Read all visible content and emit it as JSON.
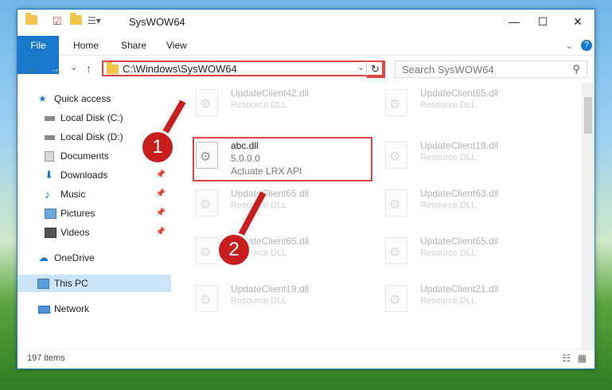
{
  "window": {
    "title": "SysWOW64",
    "minimize": "—",
    "maximize": "☐",
    "close": "✕"
  },
  "ribbon": {
    "file": "File",
    "home": "Home",
    "share": "Share",
    "view": "View",
    "help": "?",
    "collapse": "⌄"
  },
  "nav": {
    "back": "←",
    "forward": "→",
    "recent": "⌄",
    "up": "↑"
  },
  "address": {
    "path": "C:\\Windows\\SysWOW64",
    "dropdown": "⌄",
    "refresh": "↻"
  },
  "search": {
    "placeholder": "Search SysWOW64"
  },
  "sidebar": {
    "items": [
      {
        "label": "Quick access",
        "icon": "star-icon"
      },
      {
        "label": "Local Disk (C:)",
        "icon": "drive-icon"
      },
      {
        "label": "Local Disk (D:)",
        "icon": "drive-icon"
      },
      {
        "label": "Documents",
        "icon": "documents-icon"
      },
      {
        "label": "Downloads",
        "icon": "downloads-icon"
      },
      {
        "label": "Music",
        "icon": "music-icon"
      },
      {
        "label": "Pictures",
        "icon": "pictures-icon"
      },
      {
        "label": "Videos",
        "icon": "videos-icon"
      },
      {
        "label": "OneDrive",
        "icon": "cloud-icon"
      },
      {
        "label": "This PC",
        "icon": "computer-icon"
      },
      {
        "label": "Network",
        "icon": "network-icon"
      }
    ]
  },
  "files": [
    {
      "name": "UpdateClient42.dll",
      "type": "Resource DLL"
    },
    {
      "name": "UpdateClient65.dll",
      "type": "Resource DLL"
    },
    {
      "name": "abc.dll",
      "version": "5.0.0.0",
      "desc": "Actuate LRX API"
    },
    {
      "name": "UpdateClient19.dll",
      "type": "Resource DLL"
    },
    {
      "name": "UpdateClient65.dll",
      "type": "Resource DLL"
    },
    {
      "name": "UpdateClient63.dll",
      "type": "Resource DLL"
    },
    {
      "name": "UpdateClient65.dll",
      "type": "Resource DLL"
    },
    {
      "name": "UpdateClient65.dll",
      "type": "Resource DLL"
    },
    {
      "name": "UpdateClient19.dll",
      "type": "Resource DLL"
    },
    {
      "name": "UpdateClient21.dll",
      "type": "Resource DLL"
    }
  ],
  "status": {
    "count": "197 items"
  },
  "markers": {
    "one": "1",
    "two": "2"
  },
  "colors": {
    "accent": "#1979ca",
    "highlight": "#e04444",
    "marker": "#c91e1e"
  }
}
